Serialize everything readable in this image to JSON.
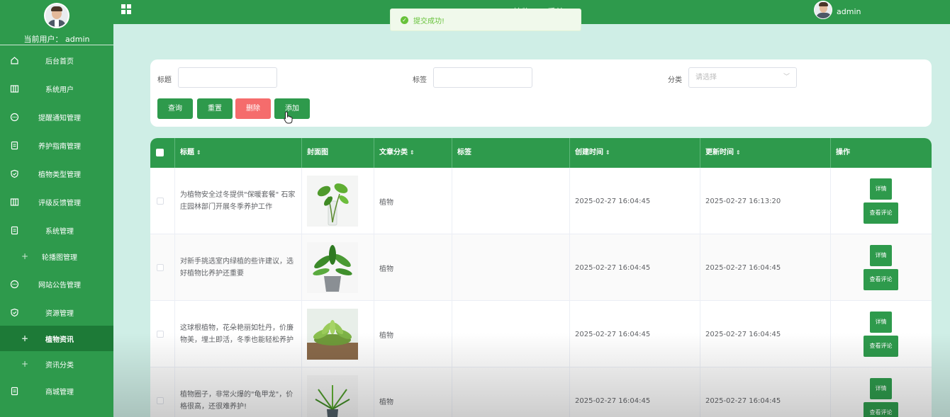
{
  "sidebar": {
    "current_user": "当前用户： admin",
    "items": [
      {
        "label": "后台首页"
      },
      {
        "label": "系统用户"
      },
      {
        "label": "提醒通知管理"
      },
      {
        "label": "养护指南管理"
      },
      {
        "label": "植物类型管理"
      },
      {
        "label": "评级反馈管理"
      },
      {
        "label": "系统管理"
      },
      {
        "label": "轮播图管理"
      },
      {
        "label": "网站公告管理"
      },
      {
        "label": "资源管理"
      },
      {
        "label": "植物资讯"
      },
      {
        "label": "资讯分类"
      },
      {
        "label": "商城管理"
      }
    ]
  },
  "topbar": {
    "title": "……植物……系统",
    "user": "admin"
  },
  "toast": {
    "message": "提交成功!"
  },
  "search": {
    "title_label": "标题",
    "tag_label": "标签",
    "category_label": "分类",
    "category_placeholder": "请选择",
    "buttons": {
      "query": "查询",
      "reset": "重置",
      "delete": "删除",
      "add": "添加"
    }
  },
  "table": {
    "columns": [
      "标题",
      "封面图",
      "文章分类",
      "标签",
      "创建时间",
      "更新时间",
      "操作"
    ],
    "rows": [
      {
        "title": "为植物安全过冬提供\"保暖套餐\" 石家庄园林部门开展冬季养护工作",
        "category": "植物",
        "tag": "",
        "created": "2025-02-27 16:04:45",
        "updated": "2025-02-27 16:13:20",
        "detail": "详情",
        "comments": "查看评论"
      },
      {
        "title": "对新手挑选室内绿植的些许建议，选好植物比养护还重要",
        "category": "植物",
        "tag": "",
        "created": "2025-02-27 16:04:45",
        "updated": "2025-02-27 16:04:45",
        "detail": "详情",
        "comments": "查看评论"
      },
      {
        "title": "这球根植物，花朵艳丽如牡丹，价廉物美，埋土即活，冬季也能轻松养护",
        "category": "植物",
        "tag": "",
        "created": "2025-02-27 16:04:45",
        "updated": "2025-02-27 16:04:45",
        "detail": "详情",
        "comments": "查看评论"
      },
      {
        "title": "植物圈子，非常火爆的\"龟甲龙\"，价格很高，还很难养护!",
        "category": "植物",
        "tag": "",
        "created": "2025-02-27 16:04:45",
        "updated": "2025-02-27 16:04:45",
        "detail": "详情",
        "comments": "查看评论"
      }
    ]
  },
  "colors": {
    "primary": "#2e9a4c",
    "active": "#1d7a37",
    "danger": "#f56c6c",
    "background": "#cfeee6",
    "success_text": "#67c23a"
  }
}
